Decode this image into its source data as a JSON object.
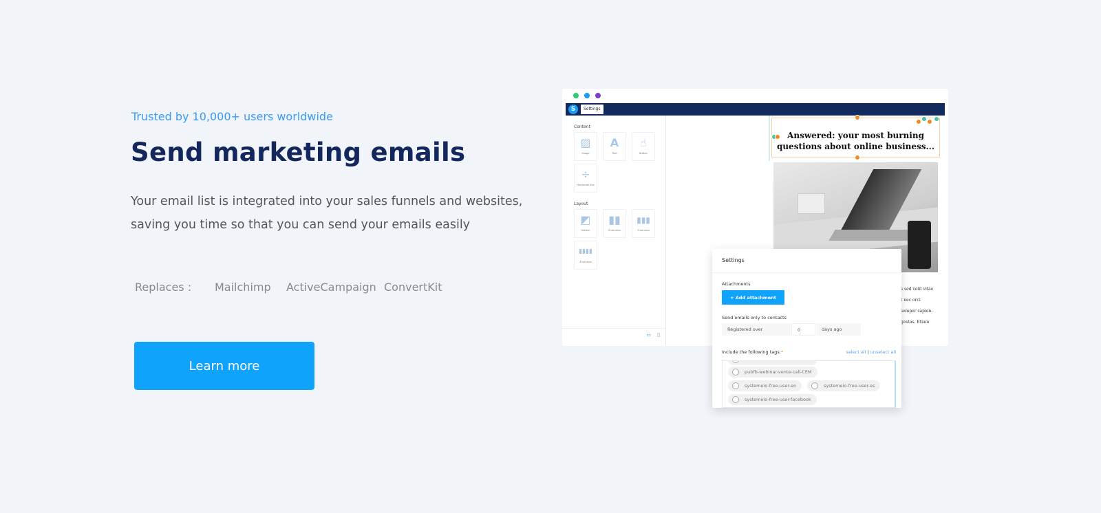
{
  "hero": {
    "tagline": "Trusted by 10,000+ users worldwide",
    "title": "Send marketing emails",
    "description": "Your email list is integrated into your sales funnels and websites, saving you time so that you can send your emails easily",
    "replaces_label": "Replaces :",
    "replaces": [
      "Mailchimp",
      "ActiveCampaign",
      "ConvertKit"
    ],
    "cta": "Learn more",
    "colors": {
      "accent": "#10a3fb",
      "title": "#14275c",
      "tagline": "#3a9bf3"
    }
  },
  "editor": {
    "window_dots": [
      "#2ecc71",
      "#1a9bf5",
      "#7b3fc9"
    ],
    "logo": "S",
    "nav_button": "Settings",
    "content_heading": "Content",
    "content_blocks": [
      {
        "label": "Image",
        "icon": "image-icon"
      },
      {
        "label": "Text",
        "icon": "text-icon"
      },
      {
        "label": "Button",
        "icon": "pointer-icon"
      },
      {
        "label": "Horizontal line",
        "icon": "divider-icon"
      }
    ],
    "layout_heading": "Layout",
    "layout_blocks": [
      {
        "label": "Section",
        "icon": "section-icon"
      },
      {
        "label": "2 columns",
        "icon": "two-columns-icon"
      },
      {
        "label": "3 columns",
        "icon": "three-columns-icon"
      },
      {
        "label": "4 columns",
        "icon": "four-columns-icon"
      }
    ],
    "email_headline": "Answered: your most burning questions about online business...",
    "body_lines": [
      "s sed velit vitae",
      "t nec orci",
      "semper sapien.",
      "gestas. Etiam"
    ]
  },
  "settings_modal": {
    "title": "Settings",
    "attachments_label": "Attachments",
    "add_attachment": "+ Add attachment",
    "send_only_label": "Send emails only to contacts",
    "registered_over": "Registered over",
    "days_value": "0",
    "days_ago": "days ago",
    "tags_label": "Include the following tags:",
    "required_mark": "*",
    "select_all": "select all",
    "separator": "|",
    "unselect_all": "unselect all",
    "tags": [
      "pubfb-webinar-vente-call-CEM",
      "systemeio-free-user-en",
      "systemeio-free-user-es",
      "systemeio-free-user-facebook"
    ]
  }
}
